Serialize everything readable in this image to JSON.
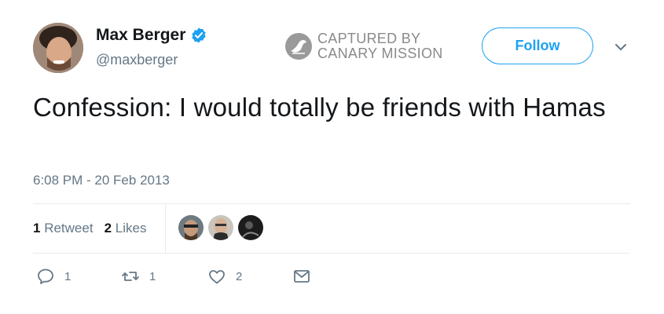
{
  "user": {
    "name": "Max Berger",
    "handle": "@maxberger",
    "verified_color": "#1da1f2"
  },
  "watermark": {
    "line1": "CAPTURED BY",
    "line2": "CANARY MISSION",
    "color": "#8a8a8a"
  },
  "follow_label": "Follow",
  "tweet": {
    "text": "Confession: I would totally be friends with Hamas",
    "timestamp": "6:08 PM - 20 Feb 2013"
  },
  "stats": {
    "retweets_count": "1",
    "retweets_label": "Retweet",
    "likes_count": "2",
    "likes_label": "Likes"
  },
  "likers": [
    "liker-avatar-1",
    "liker-avatar-2",
    "liker-avatar-3"
  ],
  "actions": {
    "reply_count": "1",
    "retweet_count": "1",
    "like_count": "2"
  },
  "colors": {
    "accent": "#1da1f2",
    "secondary_text": "#657786",
    "divider": "#e6ecf0"
  }
}
